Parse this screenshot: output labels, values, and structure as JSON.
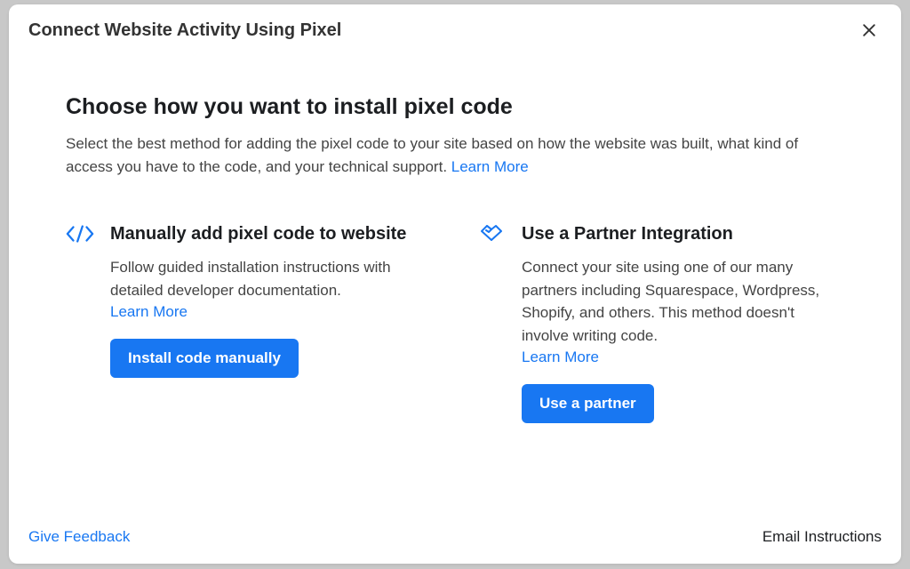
{
  "header": {
    "title": "Connect Website Activity Using Pixel"
  },
  "section": {
    "title": "Choose how you want to install pixel code",
    "desc": "Select the best method for adding the pixel code to your site based on how the website was built, what kind of access you have to the code, and your technical support. ",
    "learn_more": "Learn More"
  },
  "options": {
    "manual": {
      "title": "Manually add pixel code to website",
      "desc": "Follow guided installation instructions with detailed developer documentation.",
      "learn_more": "Learn More",
      "button": "Install code manually"
    },
    "partner": {
      "title": "Use a Partner Integration",
      "desc": "Connect your site using one of our many partners including Squarespace, Wordpress, Shopify, and others. This method doesn't involve writing code.",
      "learn_more": "Learn More",
      "button": "Use a partner"
    }
  },
  "footer": {
    "feedback": "Give Feedback",
    "email": "Email Instructions"
  }
}
